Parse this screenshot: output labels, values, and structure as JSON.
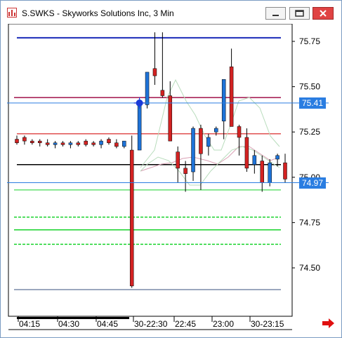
{
  "window": {
    "title": "S.SWKS - Skyworks Solutions Inc, 3 Min"
  },
  "colors": {
    "up_candle": "#1e73d8",
    "down_candle": "#d32222",
    "blue_line": "#1a2ab8",
    "maroon_line": "#a0104a",
    "green_line": "#16d22a",
    "cursor_line": "#2a7de1",
    "grid": "#000000"
  },
  "axis": {
    "labels": [
      "75.75",
      "75.50",
      "75.25",
      "75.00",
      "74.75",
      "74.50"
    ],
    "values": [
      75.75,
      75.5,
      75.25,
      75.0,
      74.75,
      74.5
    ]
  },
  "price_tags": {
    "upper": "75.41",
    "lower": "74.97"
  },
  "time_axis": [
    "04:15",
    "04:30",
    "04:45",
    "30-22:30",
    "22:45",
    "23:00",
    "30-23:15"
  ],
  "chart_data": {
    "type": "candlestick",
    "ylim": [
      74.3,
      75.8
    ],
    "candles": [
      {
        "o": 75.21,
        "h": 75.23,
        "l": 75.18,
        "c": 75.19
      },
      {
        "o": 75.22,
        "h": 75.23,
        "l": 75.18,
        "c": 75.2
      },
      {
        "o": 75.2,
        "h": 75.21,
        "l": 75.18,
        "c": 75.19
      },
      {
        "o": 75.2,
        "h": 75.21,
        "l": 75.17,
        "c": 75.19
      },
      {
        "o": 75.19,
        "h": 75.21,
        "l": 75.17,
        "c": 75.18
      },
      {
        "o": 75.18,
        "h": 75.2,
        "l": 75.16,
        "c": 75.19
      },
      {
        "o": 75.19,
        "h": 75.2,
        "l": 75.17,
        "c": 75.18
      },
      {
        "o": 75.18,
        "h": 75.2,
        "l": 75.16,
        "c": 75.19
      },
      {
        "o": 75.19,
        "h": 75.2,
        "l": 75.17,
        "c": 75.18
      },
      {
        "o": 75.2,
        "h": 75.21,
        "l": 75.17,
        "c": 75.18
      },
      {
        "o": 75.19,
        "h": 75.2,
        "l": 75.17,
        "c": 75.18
      },
      {
        "o": 75.18,
        "h": 75.21,
        "l": 75.16,
        "c": 75.2
      },
      {
        "o": 75.21,
        "h": 75.22,
        "l": 75.18,
        "c": 75.19
      },
      {
        "o": 75.19,
        "h": 75.21,
        "l": 75.16,
        "c": 75.17
      },
      {
        "o": 75.17,
        "h": 75.2,
        "l": 75.16,
        "c": 75.2
      },
      {
        "o": 75.15,
        "h": 75.23,
        "l": 74.39,
        "c": 74.4
      },
      {
        "o": 75.15,
        "h": 75.33,
        "l": 75.15,
        "c": 75.4
      },
      {
        "o": 75.4,
        "h": 75.57,
        "l": 75.38,
        "c": 75.58
      },
      {
        "o": 75.6,
        "h": 75.8,
        "l": 75.51,
        "c": 75.56
      },
      {
        "o": 75.48,
        "h": 75.8,
        "l": 75.44,
        "c": 75.45
      },
      {
        "o": 75.45,
        "h": 75.53,
        "l": 75.2,
        "c": 75.2
      },
      {
        "o": 75.14,
        "h": 75.17,
        "l": 74.97,
        "c": 75.05
      },
      {
        "o": 75.05,
        "h": 75.09,
        "l": 74.92,
        "c": 75.02
      },
      {
        "o": 75.03,
        "h": 75.28,
        "l": 74.98,
        "c": 75.27
      },
      {
        "o": 75.27,
        "h": 75.29,
        "l": 74.93,
        "c": 75.13
      },
      {
        "o": 75.17,
        "h": 75.24,
        "l": 75.12,
        "c": 75.22
      },
      {
        "o": 75.25,
        "h": 75.28,
        "l": 75.23,
        "c": 75.27
      },
      {
        "o": 75.31,
        "h": 75.54,
        "l": 75.21,
        "c": 75.54
      },
      {
        "o": 75.61,
        "h": 75.71,
        "l": 75.28,
        "c": 75.28
      },
      {
        "o": 75.28,
        "h": 75.29,
        "l": 75.12,
        "c": 75.22
      },
      {
        "o": 75.22,
        "h": 75.27,
        "l": 75.03,
        "c": 75.05
      },
      {
        "o": 75.07,
        "h": 75.15,
        "l": 75.02,
        "c": 75.12
      },
      {
        "o": 75.09,
        "h": 75.12,
        "l": 74.92,
        "c": 74.97
      },
      {
        "o": 74.97,
        "h": 75.1,
        "l": 74.95,
        "c": 75.08
      },
      {
        "o": 75.1,
        "h": 75.13,
        "l": 75.06,
        "c": 75.12
      },
      {
        "o": 75.08,
        "h": 75.13,
        "l": 74.97,
        "c": 74.99
      }
    ],
    "levels": [
      {
        "name": "blue-resistance",
        "value": 75.77,
        "color": "#1a2ab8",
        "style": "solid"
      },
      {
        "name": "maroon-level",
        "value": 75.44,
        "color": "#a0104a",
        "style": "solid"
      },
      {
        "name": "red-mid",
        "value": 75.24,
        "color": "#e05050",
        "style": "solid"
      },
      {
        "name": "black-pivot",
        "value": 75.07,
        "color": "#000000",
        "style": "solid"
      },
      {
        "name": "green-support-1",
        "value": 74.93,
        "color": "#16d22a",
        "style": "solid"
      },
      {
        "name": "green-support-2",
        "value": 74.78,
        "color": "#16d22a",
        "style": "dashed"
      },
      {
        "name": "green-support-3",
        "value": 74.71,
        "color": "#16d22a",
        "style": "solid"
      },
      {
        "name": "green-support-4",
        "value": 74.63,
        "color": "#16d22a",
        "style": "dashed"
      },
      {
        "name": "grey-low",
        "value": 74.38,
        "color": "#7a8aa8",
        "style": "solid"
      }
    ],
    "cursor_levels": [
      75.41,
      74.97
    ]
  }
}
